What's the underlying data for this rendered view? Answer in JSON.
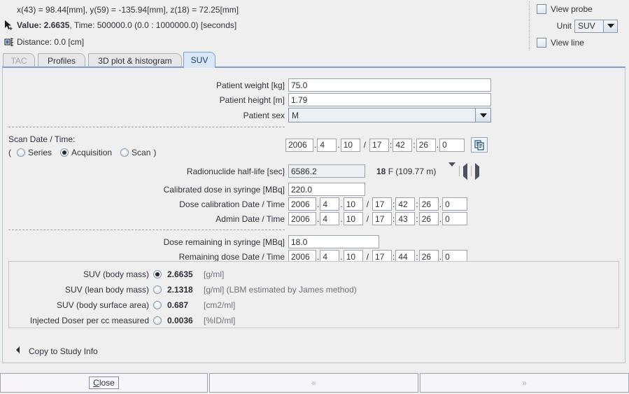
{
  "info": {
    "coords": "x(43) = 98.44[mm],  y(59) = -135.94[mm],  z(18) = 72.25[mm]",
    "value_label": "Value: 2.6635",
    "value_rest": ", Time: 500000.0 (0.0 : 1000000.0) [seconds]",
    "distance": "Distance: 0.0 [cm]"
  },
  "view_controls": {
    "view_probe_label": "View probe",
    "unit_label": "Unit",
    "unit_value": "SUV",
    "view_line_label": "View line"
  },
  "tabs": [
    {
      "label": "TAC",
      "state": "disabled"
    },
    {
      "label": "Profiles",
      "state": "normal"
    },
    {
      "label": "3D plot & histogram",
      "state": "normal"
    },
    {
      "label": "SUV",
      "state": "active"
    }
  ],
  "form": {
    "patient_weight_label": "Patient weight [kg]",
    "patient_weight_value": "75.0",
    "patient_height_label": "Patient height [m]",
    "patient_height_value": "1.79",
    "patient_sex_label": "Patient sex",
    "patient_sex_value": "M",
    "scan_datetime_label": "Scan Date / Time:",
    "scan_source_open": "(",
    "scan_source_close": ")",
    "scan_source_options": [
      "Series",
      "Acquisition",
      "Scan"
    ],
    "scan_source_selected": "Acquisition",
    "scan_date": {
      "year": "2006",
      "month": "4",
      "day": "10",
      "hour": "17",
      "min": "42",
      "sec": "26",
      "frac": "0"
    },
    "halflife_label": "Radionuclide half-life [sec]",
    "halflife_value": "6586.2",
    "isotope_mass": "18",
    "isotope_rest": " F (109.77 m)",
    "calibrated_dose_label": "Calibrated dose in syringe [MBq]",
    "calibrated_dose_value": "220.0",
    "dose_cal_label": "Dose calibration Date / Time",
    "dose_cal_date": {
      "year": "2006",
      "month": "4",
      "day": "10",
      "hour": "17",
      "min": "42",
      "sec": "26",
      "frac": "0"
    },
    "admin_label": "Admin Date / Time",
    "admin_date": {
      "year": "2006",
      "month": "4",
      "day": "10",
      "hour": "17",
      "min": "43",
      "sec": "26",
      "frac": "0"
    },
    "remaining_dose_label": "Dose remaining in syringe [MBq]",
    "remaining_dose_value": "18.0",
    "remaining_date_label": "Remaining dose Date / Time",
    "remaining_date": {
      "year": "2006",
      "month": "4",
      "day": "10",
      "hour": "17",
      "min": "44",
      "sec": "26",
      "frac": "0"
    }
  },
  "results": {
    "rows": [
      {
        "label": "SUV (body mass)",
        "selected": true,
        "value": "2.6635",
        "unit": "[g/ml]"
      },
      {
        "label": "SUV (lean body mass)",
        "selected": false,
        "value": "2.1318",
        "unit": "[g/ml] (LBM estimated by James method)"
      },
      {
        "label": "SUV (body surface area)",
        "selected": false,
        "value": "0.687",
        "unit": "[cm2/ml]"
      },
      {
        "label": "Injected Doser per cc measured",
        "selected": false,
        "value": "0.0036",
        "unit": "[%ID/ml]"
      }
    ]
  },
  "copy_row": {
    "label": "Copy to Study Info"
  },
  "buttons": {
    "close_mnemonic": "C",
    "close_rest": "lose",
    "prev": "«",
    "next": "»"
  },
  "colors": {
    "panel_bg": "#efefef",
    "accent_blue": "#7ba0cc",
    "active_tab": "#d9e7f7"
  }
}
